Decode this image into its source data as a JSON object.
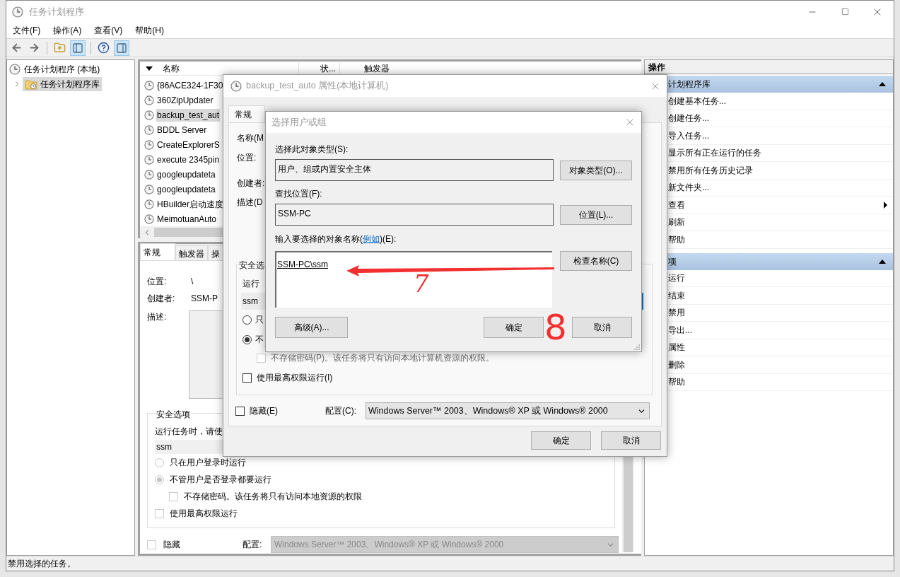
{
  "window": {
    "title": "任务计划程序"
  },
  "menu": [
    {
      "label": "文件(F)"
    },
    {
      "label": "操作(A)"
    },
    {
      "label": "查看(V)"
    },
    {
      "label": "帮助(H)"
    }
  ],
  "tree": [
    {
      "label": "任务计划程序 (本地)",
      "selected": false,
      "children": [
        {
          "label": "任务计划程序库",
          "selected": true,
          "expanded": false
        }
      ]
    }
  ],
  "task_list": {
    "columns": [
      "名称",
      "状...",
      "触发器"
    ],
    "rows": [
      {
        "name": "{86ACE324-1F30",
        "selected": false
      },
      {
        "name": "360ZipUpdater",
        "selected": false
      },
      {
        "name": "backup_test_aut",
        "selected": true
      },
      {
        "name": "BDDL Server",
        "selected": false
      },
      {
        "name": "CreateExplorerS",
        "selected": false
      },
      {
        "name": "execute 2345pin",
        "selected": false
      },
      {
        "name": "googleupdateta",
        "selected": false
      },
      {
        "name": "googleupdateta",
        "selected": false
      },
      {
        "name": "HBuilder启动速度",
        "selected": false
      },
      {
        "name": "MeimotuanAuto",
        "selected": false
      }
    ]
  },
  "details_pane": {
    "tabs": [
      {
        "label": "常规",
        "selected": true
      },
      {
        "label": "触发器",
        "selected": false
      },
      {
        "label": "操",
        "selected": false
      }
    ],
    "location_label": "位置:",
    "location": "\\",
    "author_label": "创建者:",
    "author": "SSM-P",
    "description_label": "描述:",
    "security": {
      "title": "安全选项",
      "prompt": "运行任务时，请使",
      "user": "ssm",
      "options": [
        {
          "label": "只在用户登录时运行",
          "selected": false
        },
        {
          "label": "不管用户是否登录都要运行",
          "selected": true
        }
      ],
      "no_password": {
        "label": "不存储密码。该任务将只有访问本地资源的权限",
        "checked": false
      },
      "highest": {
        "label": "使用最高权限运行",
        "checked": false
      }
    },
    "hidden": {
      "label": "隐藏",
      "checked": false
    },
    "config_label": "配置:",
    "config": "Windows Server™ 2003、Windows® XP 或 Windows® 2000"
  },
  "actions_pane": {
    "title": "操作",
    "sections": [
      {
        "title": "计划程序库",
        "expanded": true,
        "items": [
          {
            "label": "创建基本任务...",
            "kind": "plain"
          },
          {
            "label": "创建任务...",
            "kind": "plain"
          },
          {
            "label": "导入任务...",
            "kind": "plain"
          },
          {
            "label": "显示所有正在运行的任务",
            "kind": "plain"
          },
          {
            "label": "禁用所有任务历史记录",
            "kind": "plain"
          },
          {
            "label": "新文件夹...",
            "kind": "plain"
          },
          {
            "label": "查看",
            "kind": "submenu"
          },
          {
            "label": "刷新",
            "kind": "plain"
          },
          {
            "label": "帮助",
            "kind": "plain"
          }
        ]
      },
      {
        "title": "项",
        "expanded": true,
        "items": [
          {
            "label": "运行",
            "kind": "plain"
          },
          {
            "label": "结束",
            "kind": "plain"
          },
          {
            "label": "禁用",
            "kind": "plain"
          },
          {
            "label": "导出...",
            "kind": "plain"
          },
          {
            "label": "属性",
            "kind": "plain"
          },
          {
            "label": "删除",
            "kind": "plain"
          },
          {
            "label": "帮助",
            "kind": "plain"
          }
        ]
      }
    ]
  },
  "status_bar": {
    "text": "禁用选择的任务。"
  },
  "properties_dialog": {
    "title": "backup_test_auto 属性(本地计算机)",
    "tabs": [
      {
        "label": "常规",
        "selected": true
      }
    ],
    "labels": [
      "名称(M",
      "位置:",
      "创建者:",
      "描述(D"
    ],
    "security": {
      "title": "安全选",
      "prompt": "运行",
      "user": "ssm",
      "options": [
        {
          "label": "只",
          "selected": false
        },
        {
          "label": "不",
          "selected": true
        }
      ],
      "no_password": {
        "label": "不存储密码(P)。该任务将只有访问本地计算机资源的权限。",
        "checked": false,
        "disabled": true
      },
      "highest": {
        "label": "使用最高权限运行(I)",
        "checked": false,
        "disabled": false
      }
    },
    "hidden": {
      "label": "隐藏(E)",
      "checked": false
    },
    "config_label": "配置(C):",
    "config": "Windows Server™ 2003、Windows® XP 或 Windows® 2000",
    "buttons": [
      "确定",
      "取消"
    ]
  },
  "select_dialog": {
    "title": "选择用户或组",
    "object_type_label": "选择此对象类型(S):",
    "object_type": "用户、组或内置安全主体",
    "object_type_button": "对象类型(O)...",
    "location_label": "查找位置(F):",
    "location": "SSM-PC",
    "location_button": "位置(L)...",
    "names_label_before": "输入要选择的对象名称(",
    "names_label_link": "例如",
    "names_label_after": ")(E):",
    "names": "SSM-PC\\ssm",
    "check_button": "检查名称(C)",
    "advanced_button": "高级(A)...",
    "ok_button": "确定",
    "cancel_button": "取消"
  },
  "annotations": [
    "7",
    "8"
  ]
}
